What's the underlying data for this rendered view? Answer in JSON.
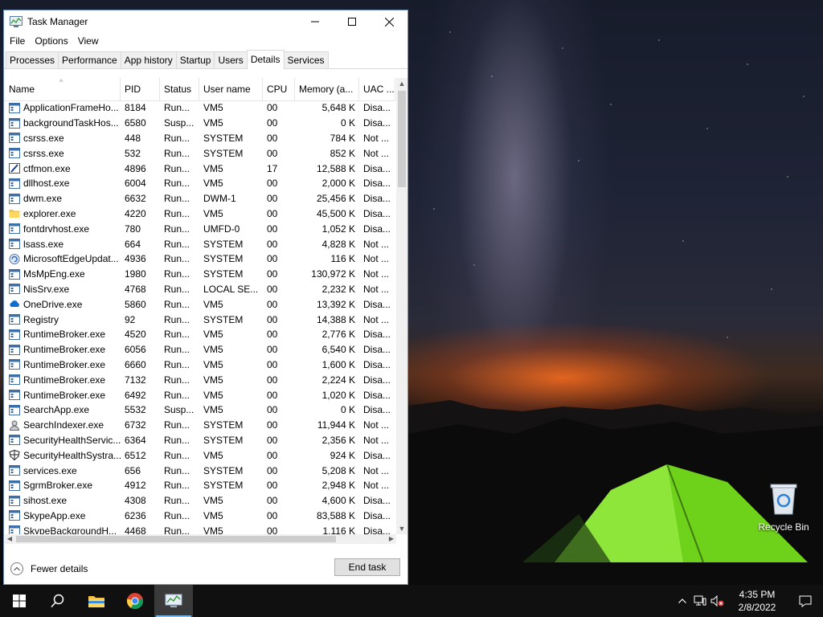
{
  "window": {
    "title": "Task Manager",
    "menu": [
      "File",
      "Options",
      "View"
    ],
    "tabs": [
      "Processes",
      "Performance",
      "App history",
      "Startup",
      "Users",
      "Details",
      "Services"
    ],
    "active_tab": "Details"
  },
  "table": {
    "columns": [
      "Name",
      "PID",
      "Status",
      "User name",
      "CPU",
      "Memory (a...",
      "UAC ..."
    ],
    "sorted_column": "Name",
    "rows": [
      {
        "name": "ApplicationFrameHo...",
        "pid": "8184",
        "status": "Run...",
        "user": "VM5",
        "cpu": "00",
        "mem": "5,648 K",
        "uac": "Disa...",
        "icon": "app-window-icon"
      },
      {
        "name": "backgroundTaskHos...",
        "pid": "6580",
        "status": "Susp...",
        "user": "VM5",
        "cpu": "00",
        "mem": "0 K",
        "uac": "Disa...",
        "icon": "app-window-icon"
      },
      {
        "name": "csrss.exe",
        "pid": "448",
        "status": "Run...",
        "user": "SYSTEM",
        "cpu": "00",
        "mem": "784 K",
        "uac": "Not ...",
        "icon": "app-window-icon"
      },
      {
        "name": "csrss.exe",
        "pid": "532",
        "status": "Run...",
        "user": "SYSTEM",
        "cpu": "00",
        "mem": "852 K",
        "uac": "Not ...",
        "icon": "app-window-icon"
      },
      {
        "name": "ctfmon.exe",
        "pid": "4896",
        "status": "Run...",
        "user": "VM5",
        "cpu": "17",
        "mem": "12,588 K",
        "uac": "Disa...",
        "icon": "pen-icon"
      },
      {
        "name": "dllhost.exe",
        "pid": "6004",
        "status": "Run...",
        "user": "VM5",
        "cpu": "00",
        "mem": "2,000 K",
        "uac": "Disa...",
        "icon": "app-window-icon"
      },
      {
        "name": "dwm.exe",
        "pid": "6632",
        "status": "Run...",
        "user": "DWM-1",
        "cpu": "00",
        "mem": "25,456 K",
        "uac": "Disa...",
        "icon": "app-window-icon"
      },
      {
        "name": "explorer.exe",
        "pid": "4220",
        "status": "Run...",
        "user": "VM5",
        "cpu": "00",
        "mem": "45,500 K",
        "uac": "Disa...",
        "icon": "folder-icon"
      },
      {
        "name": "fontdrvhost.exe",
        "pid": "780",
        "status": "Run...",
        "user": "UMFD-0",
        "cpu": "00",
        "mem": "1,052 K",
        "uac": "Disa...",
        "icon": "app-window-icon"
      },
      {
        "name": "lsass.exe",
        "pid": "664",
        "status": "Run...",
        "user": "SYSTEM",
        "cpu": "00",
        "mem": "4,828 K",
        "uac": "Not ...",
        "icon": "app-window-icon"
      },
      {
        "name": "MicrosoftEdgeUpdat...",
        "pid": "4936",
        "status": "Run...",
        "user": "SYSTEM",
        "cpu": "00",
        "mem": "116 K",
        "uac": "Not ...",
        "icon": "edge-update-icon"
      },
      {
        "name": "MsMpEng.exe",
        "pid": "1980",
        "status": "Run...",
        "user": "SYSTEM",
        "cpu": "00",
        "mem": "130,972 K",
        "uac": "Not ...",
        "icon": "app-window-icon"
      },
      {
        "name": "NisSrv.exe",
        "pid": "4768",
        "status": "Run...",
        "user": "LOCAL SE...",
        "cpu": "00",
        "mem": "2,232 K",
        "uac": "Not ...",
        "icon": "app-window-icon"
      },
      {
        "name": "OneDrive.exe",
        "pid": "5860",
        "status": "Run...",
        "user": "VM5",
        "cpu": "00",
        "mem": "13,392 K",
        "uac": "Disa...",
        "icon": "cloud-icon"
      },
      {
        "name": "Registry",
        "pid": "92",
        "status": "Run...",
        "user": "SYSTEM",
        "cpu": "00",
        "mem": "14,388 K",
        "uac": "Not ...",
        "icon": "app-window-icon"
      },
      {
        "name": "RuntimeBroker.exe",
        "pid": "4520",
        "status": "Run...",
        "user": "VM5",
        "cpu": "00",
        "mem": "2,776 K",
        "uac": "Disa...",
        "icon": "app-window-icon"
      },
      {
        "name": "RuntimeBroker.exe",
        "pid": "6056",
        "status": "Run...",
        "user": "VM5",
        "cpu": "00",
        "mem": "6,540 K",
        "uac": "Disa...",
        "icon": "app-window-icon"
      },
      {
        "name": "RuntimeBroker.exe",
        "pid": "6660",
        "status": "Run...",
        "user": "VM5",
        "cpu": "00",
        "mem": "1,600 K",
        "uac": "Disa...",
        "icon": "app-window-icon"
      },
      {
        "name": "RuntimeBroker.exe",
        "pid": "7132",
        "status": "Run...",
        "user": "VM5",
        "cpu": "00",
        "mem": "2,224 K",
        "uac": "Disa...",
        "icon": "app-window-icon"
      },
      {
        "name": "RuntimeBroker.exe",
        "pid": "6492",
        "status": "Run...",
        "user": "VM5",
        "cpu": "00",
        "mem": "1,020 K",
        "uac": "Disa...",
        "icon": "app-window-icon"
      },
      {
        "name": "SearchApp.exe",
        "pid": "5532",
        "status": "Susp...",
        "user": "VM5",
        "cpu": "00",
        "mem": "0 K",
        "uac": "Disa...",
        "icon": "app-window-icon"
      },
      {
        "name": "SearchIndexer.exe",
        "pid": "6732",
        "status": "Run...",
        "user": "SYSTEM",
        "cpu": "00",
        "mem": "11,944 K",
        "uac": "Not ...",
        "icon": "indexer-icon"
      },
      {
        "name": "SecurityHealthServic...",
        "pid": "6364",
        "status": "Run...",
        "user": "SYSTEM",
        "cpu": "00",
        "mem": "2,356 K",
        "uac": "Not ...",
        "icon": "app-window-icon"
      },
      {
        "name": "SecurityHealthSystra...",
        "pid": "6512",
        "status": "Run...",
        "user": "VM5",
        "cpu": "00",
        "mem": "924 K",
        "uac": "Disa...",
        "icon": "shield-icon"
      },
      {
        "name": "services.exe",
        "pid": "656",
        "status": "Run...",
        "user": "SYSTEM",
        "cpu": "00",
        "mem": "5,208 K",
        "uac": "Not ...",
        "icon": "app-window-icon"
      },
      {
        "name": "SgrmBroker.exe",
        "pid": "4912",
        "status": "Run...",
        "user": "SYSTEM",
        "cpu": "00",
        "mem": "2,948 K",
        "uac": "Not ...",
        "icon": "app-window-icon"
      },
      {
        "name": "sihost.exe",
        "pid": "4308",
        "status": "Run...",
        "user": "VM5",
        "cpu": "00",
        "mem": "4,600 K",
        "uac": "Disa...",
        "icon": "app-window-icon"
      },
      {
        "name": "SkypeApp.exe",
        "pid": "6236",
        "status": "Run...",
        "user": "VM5",
        "cpu": "00",
        "mem": "83,588 K",
        "uac": "Disa...",
        "icon": "app-window-icon"
      },
      {
        "name": "SkypeBackgroundH...",
        "pid": "4468",
        "status": "Run...",
        "user": "VM5",
        "cpu": "00",
        "mem": "1,116 K",
        "uac": "Disa...",
        "icon": "app-window-icon"
      }
    ]
  },
  "footer": {
    "fewer_details": "Fewer details",
    "end_task": "End task"
  },
  "desktop": {
    "recycle_bin_label": "Recycle Bin"
  },
  "taskbar": {
    "time": "4:35 PM",
    "date": "2/8/2022",
    "pinned": [
      "start-icon",
      "search-icon",
      "file-explorer-icon",
      "chrome-icon",
      "task-manager-icon"
    ]
  },
  "colors": {
    "accent": "#76b9ed",
    "tab_border": "#d9d9d9",
    "taskbar": "#101010"
  }
}
